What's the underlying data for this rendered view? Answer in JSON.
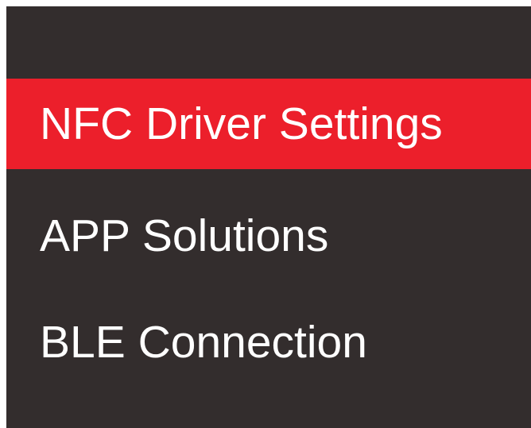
{
  "menu": {
    "items": [
      {
        "label": "NFC Driver Settings",
        "selected": true
      },
      {
        "label": "APP Solutions",
        "selected": false
      },
      {
        "label": "BLE Connection",
        "selected": false
      }
    ]
  },
  "colors": {
    "panel_background": "#332d2d",
    "selected_background": "#ec1f2b",
    "text": "#ffffff"
  }
}
